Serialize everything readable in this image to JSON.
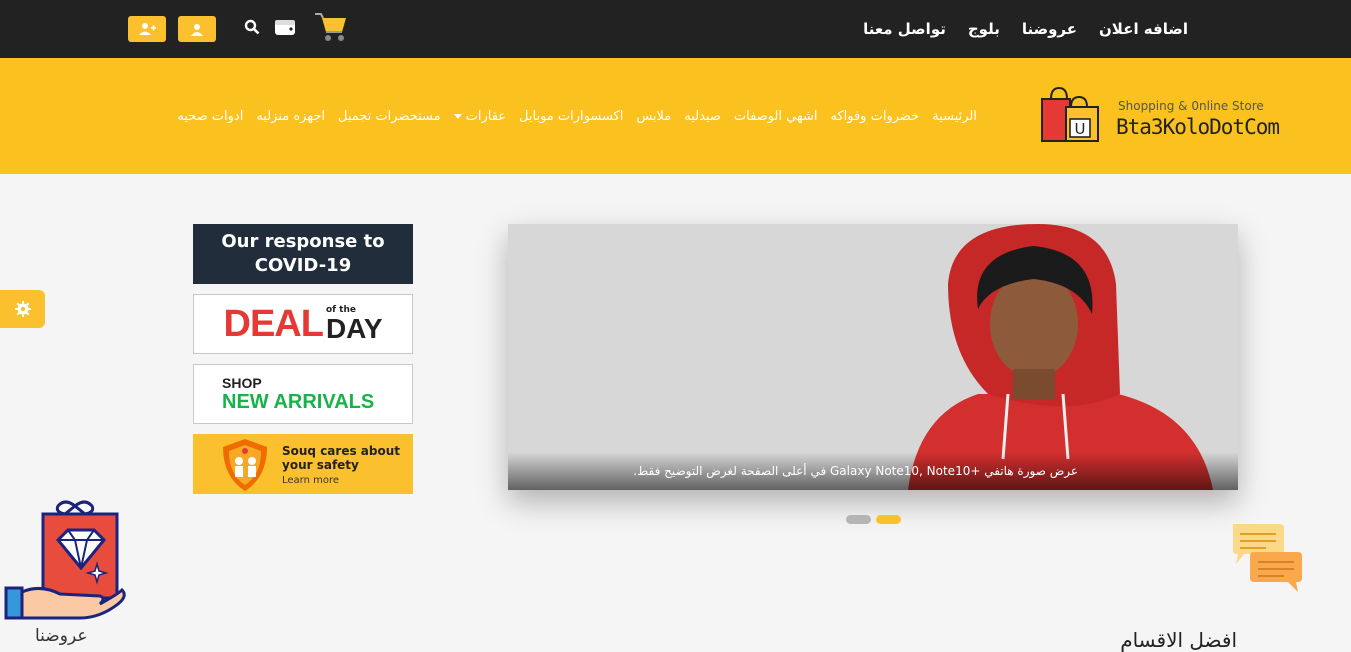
{
  "topbar": {
    "links": [
      "اضافه اعلان",
      "عروضنا",
      "بلوج",
      "تواصل معنا"
    ],
    "icons": [
      "user-plus-icon",
      "user-icon",
      "search-icon",
      "wallet-icon",
      "cart-icon"
    ]
  },
  "logo": {
    "tagline": "Shopping & 0nline Store",
    "name": "Bta3KoloDotCom",
    "bag_letter": "U"
  },
  "nav": {
    "items": [
      "الرئيسية",
      "خضروات وفواكه",
      "اشهي الوصفات",
      "صيدليه",
      "ملابس",
      "اكسسوارات موبايل",
      "عقارات",
      "مستحضرات تجميل",
      "اجهزه منزليه",
      "ادوات صحيه"
    ]
  },
  "banners": {
    "covid": {
      "line1": "Our response to",
      "line2": "COVID-19"
    },
    "deal": {
      "word": "DEAL",
      "of_the": "of the",
      "day": "DAY"
    },
    "arrivals": {
      "line1": "SHOP",
      "line2": "NEW ARRIVALS"
    },
    "souq": {
      "line1": "Souq cares about your safety",
      "line2": "Learn more"
    }
  },
  "carousel": {
    "caption": "عرض صورة هاتفي +Galaxy Note10, Note10 في أعلى الصفحة لغرض التوضيح فقط.",
    "slide_count": 2,
    "active_index": 1
  },
  "floating": {
    "offers_label": "عروضنا"
  },
  "section": {
    "title": "افضل الاقسام"
  },
  "colors": {
    "accent": "#fbc11e",
    "topbar": "#222222"
  }
}
